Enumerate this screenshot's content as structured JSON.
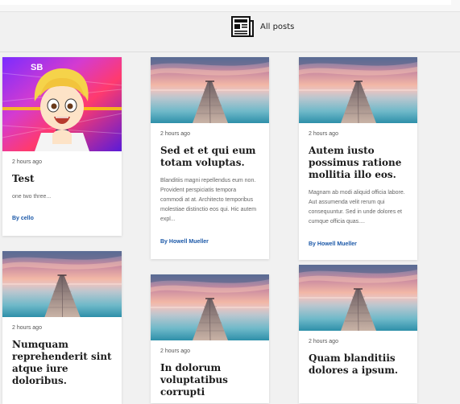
{
  "header": {
    "title": "All posts",
    "icon": "newspaper-icon"
  },
  "avatar_badge": "SB",
  "posts": [
    {
      "time": "2 hours ago",
      "title": "Test",
      "excerpt": "one two three...",
      "author": "By cello"
    },
    {
      "time": "2 hours ago",
      "title": "Sed et et qui eum totam voluptas.",
      "excerpt": "Blanditiis magni repellendus eum non. Provident perspiciatis tempora commodi at at. Architecto temporibus molestiae distinctio eos qui. Hic autem expl...",
      "author": "By Howell Mueller"
    },
    {
      "time": "2 hours ago",
      "title": "Autem iusto possimus ratione mollitia illo eos.",
      "excerpt": "Magnam ab modi aliquid officia labore. Aut assumenda velit rerum qui consequuntur. Sed in unde dolores et cumque officia quas....",
      "author": "By Howell Mueller"
    },
    {
      "time": "2 hours ago",
      "title": "Numquam reprehenderit sint atque iure doloribus."
    },
    {
      "time": "2 hours ago",
      "title": "In dolorum voluptatibus corrupti"
    },
    {
      "time": "2 hours ago",
      "title": "Quam blanditiis dolores a ipsum."
    }
  ],
  "colors": {
    "accent": "#1b58a8",
    "background": "#f1f1f1"
  }
}
